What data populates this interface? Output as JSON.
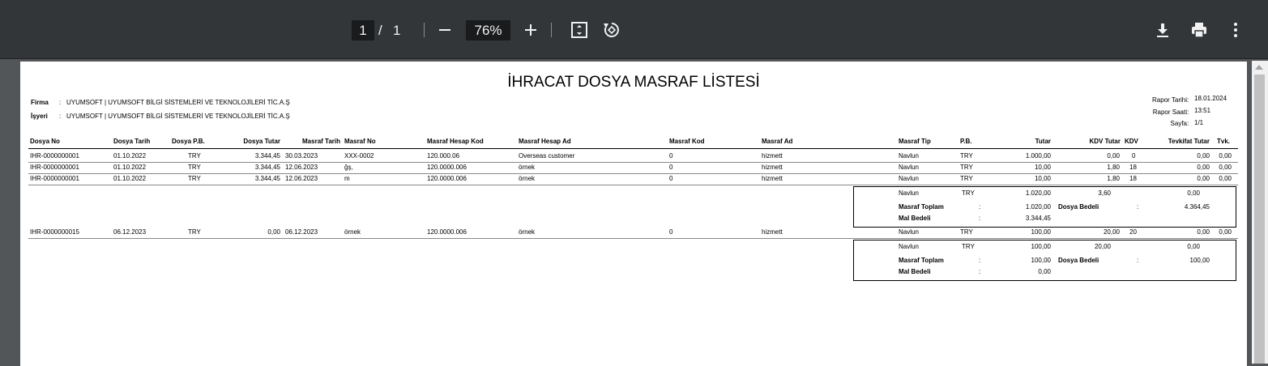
{
  "toolbar": {
    "page_current": "1",
    "page_sep": "/",
    "page_total": "1",
    "zoom": "76%"
  },
  "report": {
    "title": "İHRACAT DOSYA MASRAF LİSTESİ",
    "firma_label": "Firma",
    "firma_value": "UYUMSOFT | UYUMSOFT BİLGİ SİSTEMLERİ VE TEKNOLOJİLERİ TİC.A.Ş",
    "isyeri_label": "İşyeri",
    "isyeri_value": "UYUMSOFT | UYUMSOFT BİLGİ SİSTEMLERİ VE TEKNOLOJİLERİ TİC.A.Ş",
    "colon": ":",
    "rapor_tarihi_label": "Rapor Tarihi",
    "rapor_tarihi": "18.01.2024",
    "rapor_saati_label": "Rapor Saati",
    "rapor_saati": "13:51",
    "sayfa_label": "Sayfa",
    "sayfa": "1/1"
  },
  "columns": {
    "dosya_no": "Dosya No",
    "dosya_tarih": "Dosya Tarih",
    "dosya_pb": "Dosya P.B.",
    "dosya_tutar": "Dosya Tutar",
    "masraf_tarih": "Masraf Tarih",
    "masraf_no": "Masraf No",
    "masraf_hesap_kod": "Masraf Hesap Kod",
    "masraf_hesap_ad": "Masraf Hesap Ad",
    "masraf_kod": "Masraf Kod",
    "masraf_ad": "Masraf Ad",
    "masraf_tip": "Masraf Tip",
    "pb": "P.B.",
    "tutar": "Tutar",
    "kdv_tutar": "KDV Tutar",
    "kdv": "KDV",
    "tevkifat_tutar": "Tevkifat Tutar",
    "tvk": "Tvk."
  },
  "groups": [
    {
      "rows": [
        {
          "dosya_no": "IHR-0000000001",
          "dosya_tarih": "01.10.2022",
          "dosya_pb": "TRY",
          "dosya_tutar": "3.344,45",
          "masraf_tarih": "30.03.2023",
          "masraf_no": "XXX-0002",
          "hesap_kod": "120.000.06",
          "hesap_ad": "Overseas customer",
          "masraf_kod": "0",
          "masraf_ad": "hizmett",
          "tip": "Navlun",
          "pb": "TRY",
          "tutar": "1.000,00",
          "kdv_tutar": "0,00",
          "kdv": "0",
          "tevkifat": "0,00",
          "tvk": "0,00"
        },
        {
          "dosya_no": "IHR-0000000001",
          "dosya_tarih": "01.10.2022",
          "dosya_pb": "TRY",
          "dosya_tutar": "3.344,45",
          "masraf_tarih": "12.06.2023",
          "masraf_no": "ğş,",
          "hesap_kod": "120.0000.006",
          "hesap_ad": "örnek",
          "masraf_kod": "0",
          "masraf_ad": "hizmett",
          "tip": "Navlun",
          "pb": "TRY",
          "tutar": "10,00",
          "kdv_tutar": "1,80",
          "kdv": "18",
          "tevkifat": "0,00",
          "tvk": "0,00"
        },
        {
          "dosya_no": "IHR-0000000001",
          "dosya_tarih": "01.10.2022",
          "dosya_pb": "TRY",
          "dosya_tutar": "3.344,45",
          "masraf_tarih": "12.06.2023",
          "masraf_no": "m",
          "hesap_kod": "120.0000.006",
          "hesap_ad": "örnek",
          "masraf_kod": "0",
          "masraf_ad": "hizmett",
          "tip": "Navlun",
          "pb": "TRY",
          "tutar": "10,00",
          "kdv_tutar": "1,80",
          "kdv": "18",
          "tevkifat": "0,00",
          "tvk": "0,00"
        }
      ],
      "summary": {
        "tip": "Navlun",
        "pb": "TRY",
        "tutar": "1.020,00",
        "kdv_tutar": "3,60",
        "tevkifat": "0,00",
        "masraf_toplam_label": "Masraf Toplam",
        "masraf_toplam": "1.020,00",
        "dosya_bedeli_label": "Dosya Bedeli",
        "dosya_bedeli": "4.364,45",
        "mal_bedeli_label": "Mal Bedeli",
        "mal_bedeli": "3.344,45"
      }
    },
    {
      "rows": [
        {
          "dosya_no": "IHR-0000000015",
          "dosya_tarih": "06.12.2023",
          "dosya_pb": "TRY",
          "dosya_tutar": "0,00",
          "masraf_tarih": "06.12.2023",
          "masraf_no": "örnek",
          "hesap_kod": "120.0000.006",
          "hesap_ad": "örnek",
          "masraf_kod": "0",
          "masraf_ad": "hizmett",
          "tip": "Navlun",
          "pb": "TRY",
          "tutar": "100,00",
          "kdv_tutar": "20,00",
          "kdv": "20",
          "tevkifat": "0,00",
          "tvk": "0,00"
        }
      ],
      "summary": {
        "tip": "Navlun",
        "pb": "TRY",
        "tutar": "100,00",
        "kdv_tutar": "20,00",
        "tevkifat": "0,00",
        "masraf_toplam_label": "Masraf Toplam",
        "masraf_toplam": "100,00",
        "dosya_bedeli_label": "Dosya Bedeli",
        "dosya_bedeli": "100,00",
        "mal_bedeli_label": "Mal Bedeli",
        "mal_bedeli": "0,00"
      }
    }
  ]
}
